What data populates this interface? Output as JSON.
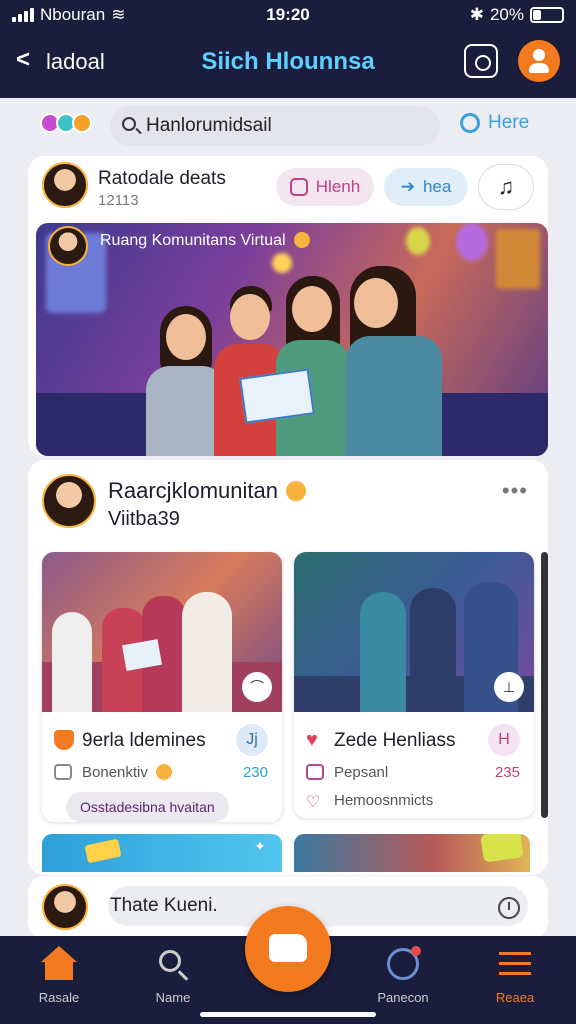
{
  "status": {
    "carrier": "Nbouran",
    "time": "19:20",
    "battery": "20%"
  },
  "topbar": {
    "back_label": "ladoal",
    "title": "Siich Hlounnsa"
  },
  "search": {
    "value": "Hanlorumidsail",
    "here_label": "Here"
  },
  "post1": {
    "name": "Ratodale deats",
    "sub": "12113",
    "pill1": "Hlenh",
    "pill2": "hea",
    "pill3": "♫",
    "hero_caption": "Ruang Komunitans Virtual"
  },
  "post2": {
    "name": "Raarcjklomunitan",
    "sub": "Viitba39"
  },
  "items": [
    {
      "title": "9erla ldemines",
      "badge": "Jj",
      "meta": "Bonenktiv",
      "num": "230",
      "tag": "Osstadesibna hvaitan"
    },
    {
      "title": "Zede Henliass",
      "badge": "H",
      "meta": "Pepsanl",
      "num": "235",
      "line2": "Hemoosnmicts"
    }
  ],
  "composer": {
    "placeholder": "Thate Kueni."
  },
  "nav": {
    "items": [
      "Rasale",
      "Name",
      "",
      "Panecon",
      "Reaea"
    ]
  },
  "colors": {
    "accent": "#f47a1f",
    "bar": "#1b1d3c",
    "title": "#5ed0ff"
  }
}
